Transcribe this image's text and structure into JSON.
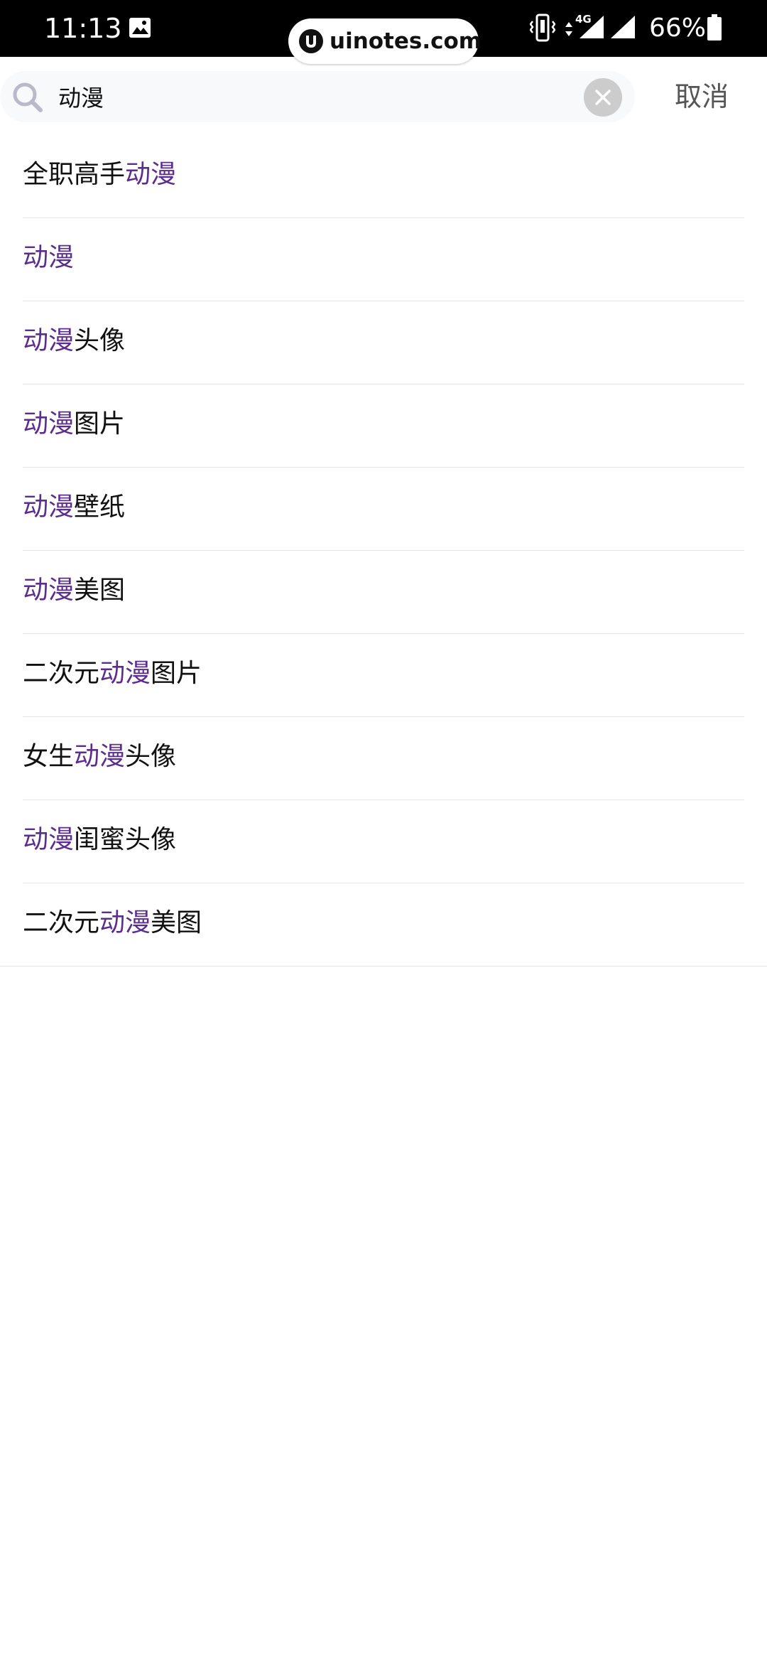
{
  "status_bar": {
    "time": "11:13",
    "network": "4G",
    "battery": "66%"
  },
  "watermark": {
    "text": "uinotes.com"
  },
  "search": {
    "query": "动漫",
    "cancel_label": "取消"
  },
  "highlight_color": "#5b2d8e",
  "suggestions": [
    {
      "parts": [
        {
          "text": "全职高手",
          "hl": false
        },
        {
          "text": "动漫",
          "hl": true
        }
      ]
    },
    {
      "parts": [
        {
          "text": "动漫",
          "hl": true
        }
      ]
    },
    {
      "parts": [
        {
          "text": "动漫",
          "hl": true
        },
        {
          "text": "头像",
          "hl": false
        }
      ]
    },
    {
      "parts": [
        {
          "text": "动漫",
          "hl": true
        },
        {
          "text": "图片",
          "hl": false
        }
      ]
    },
    {
      "parts": [
        {
          "text": "动漫",
          "hl": true
        },
        {
          "text": "壁纸",
          "hl": false
        }
      ]
    },
    {
      "parts": [
        {
          "text": "动漫",
          "hl": true
        },
        {
          "text": "美图",
          "hl": false
        }
      ]
    },
    {
      "parts": [
        {
          "text": "二次元",
          "hl": false
        },
        {
          "text": "动漫",
          "hl": true
        },
        {
          "text": "图片",
          "hl": false
        }
      ]
    },
    {
      "parts": [
        {
          "text": "女生",
          "hl": false
        },
        {
          "text": "动漫",
          "hl": true
        },
        {
          "text": "头像",
          "hl": false
        }
      ]
    },
    {
      "parts": [
        {
          "text": "动漫",
          "hl": true
        },
        {
          "text": "闺蜜头像",
          "hl": false
        }
      ]
    },
    {
      "parts": [
        {
          "text": "二次元",
          "hl": false
        },
        {
          "text": "动漫",
          "hl": true
        },
        {
          "text": "美图",
          "hl": false
        }
      ]
    }
  ]
}
